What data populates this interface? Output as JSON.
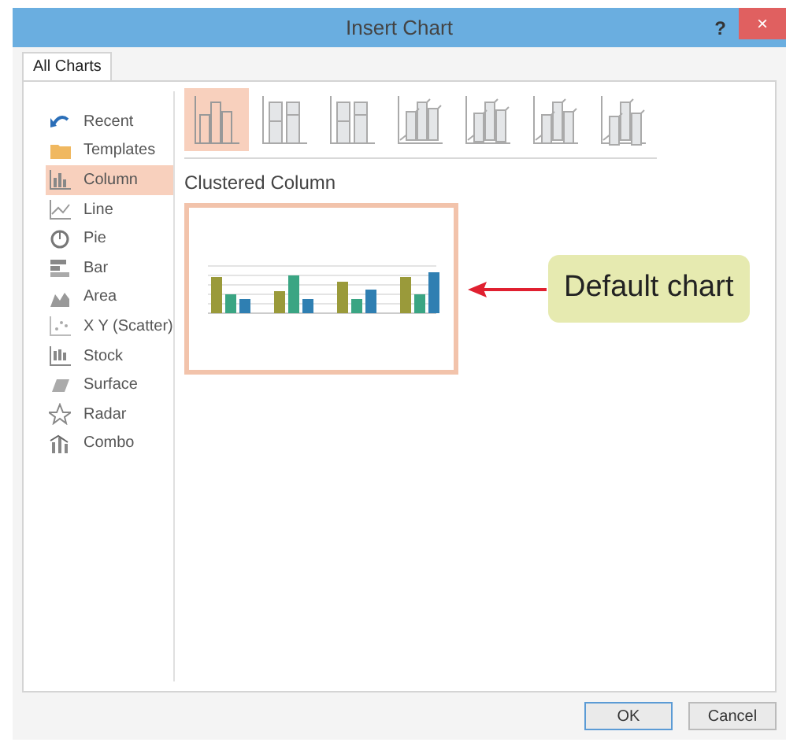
{
  "window": {
    "title": "Insert Chart",
    "help": "?",
    "close": "×"
  },
  "tabs": [
    {
      "label": "All Charts",
      "selected": true
    }
  ],
  "sidebar": {
    "items": [
      {
        "label": "Recent",
        "selected": false
      },
      {
        "label": "Templates",
        "selected": false
      },
      {
        "label": "Column",
        "selected": true
      },
      {
        "label": "Line",
        "selected": false
      },
      {
        "label": "Pie",
        "selected": false
      },
      {
        "label": "Bar",
        "selected": false
      },
      {
        "label": "Area",
        "selected": false
      },
      {
        "label": "X Y (Scatter)",
        "selected": false
      },
      {
        "label": "Stock",
        "selected": false
      },
      {
        "label": "Surface",
        "selected": false
      },
      {
        "label": "Radar",
        "selected": false
      },
      {
        "label": "Combo",
        "selected": false
      }
    ]
  },
  "subtypes": [
    {
      "selected": true
    },
    {
      "selected": false
    },
    {
      "selected": false
    },
    {
      "selected": false
    },
    {
      "selected": false
    },
    {
      "selected": false
    },
    {
      "selected": false
    }
  ],
  "subtype_title": "Clustered Column",
  "callout": {
    "text": "Default chart"
  },
  "buttons": [
    {
      "label": "OK",
      "selected": true
    },
    {
      "label": "Cancel",
      "selected": false
    }
  ]
}
